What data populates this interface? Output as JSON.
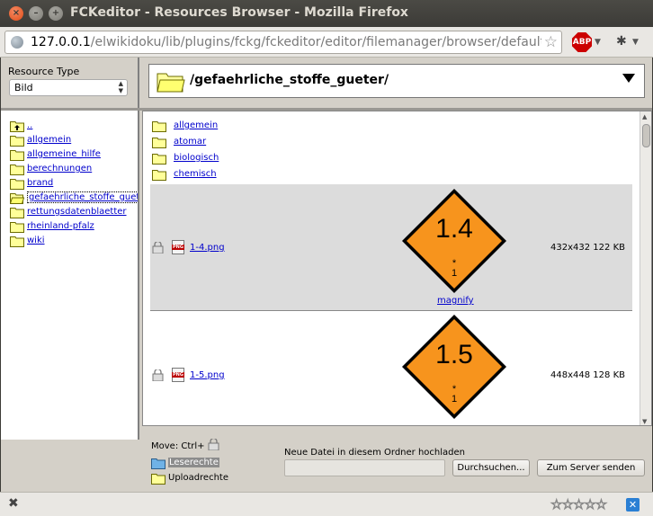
{
  "window": {
    "title": "FCKeditor - Resources Browser - Mozilla Firefox",
    "close_glyph": "×",
    "min_glyph": "–",
    "max_glyph": "+"
  },
  "navbar": {
    "url_host": "127.0.0.1",
    "url_path": "/elwikidoku/lib/plugins/fckg/fckeditor/editor/filemanager/browser/default/",
    "star_glyph": "☆",
    "abp_label": "ABP",
    "dropdown_glyph": "▼",
    "bug_glyph": "✱"
  },
  "resource_type": {
    "label": "Resource Type",
    "selected": "Bild",
    "arrows": "▲▼"
  },
  "current_folder": {
    "path": "/gefaehrliche_stoffe_gueter/"
  },
  "tree": {
    "items": [
      {
        "label": ".."
      },
      {
        "label": "allgemein"
      },
      {
        "label": "allgemeine_hilfe"
      },
      {
        "label": "berechnungen"
      },
      {
        "label": "brand"
      },
      {
        "label": "gefaehrliche_stoffe_gueter"
      },
      {
        "label": "rettungsdatenblaetter"
      },
      {
        "label": "rheinland-pfalz"
      },
      {
        "label": "wiki"
      }
    ]
  },
  "files": {
    "folders": [
      {
        "label": "allgemein"
      },
      {
        "label": "atomar"
      },
      {
        "label": "biologisch"
      },
      {
        "label": "chemisch"
      }
    ],
    "images": [
      {
        "name": "1-4.png",
        "meta": "432x432 122 KB",
        "big": "1.4",
        "small": "*",
        "num": "1",
        "magnify": "magnify",
        "png_tag": "PNG"
      },
      {
        "name": "1-5.png",
        "meta": "448x448 128 KB",
        "big": "1.5",
        "small": "*",
        "num": "1",
        "png_tag": "PNG"
      }
    ]
  },
  "bottom": {
    "move_label": "Move: Ctrl+",
    "perm_read": "Leserechte",
    "perm_upload": "Uploadrechte",
    "upload_label": "Neue Datei in diesem Ordner hochladen",
    "browse_btn": "Durchsuchen...",
    "send_btn": "Zum Server senden"
  },
  "statusbar": {
    "close_glyph": "✖",
    "rating": "☆☆☆☆☆",
    "addon_glyph": "✕"
  },
  "colors": {
    "link": "#0000cc",
    "folder_fill": "#ffff99",
    "diamond_orange": "#f7941d",
    "gray_row": "#dcdcdc"
  }
}
